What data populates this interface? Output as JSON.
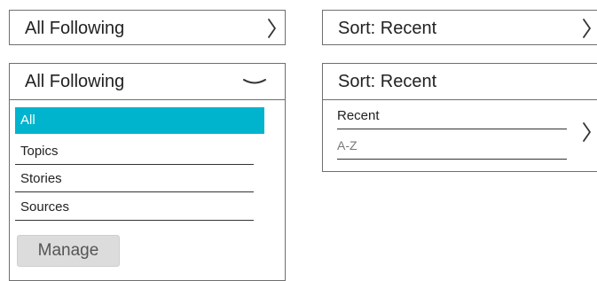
{
  "following_collapsed": {
    "title": "All Following",
    "icon": "chevron-right-icon"
  },
  "sort_collapsed": {
    "title": "Sort: Recent",
    "icon": "chevron-right-icon"
  },
  "following_expanded": {
    "title": "All Following",
    "icon": "chevron-down-icon",
    "items": [
      {
        "label": "All",
        "selected": true
      },
      {
        "label": "Topics",
        "selected": false
      },
      {
        "label": "Stories",
        "selected": false
      },
      {
        "label": "Sources",
        "selected": false
      }
    ],
    "manage_label": "Manage",
    "selected_color": "#00b4cd"
  },
  "sort_expanded": {
    "title": "Sort: Recent",
    "options": [
      {
        "label": "Recent",
        "selected": true
      },
      {
        "label": "A-Z",
        "selected": false
      }
    ],
    "icon": "chevron-right-icon"
  }
}
